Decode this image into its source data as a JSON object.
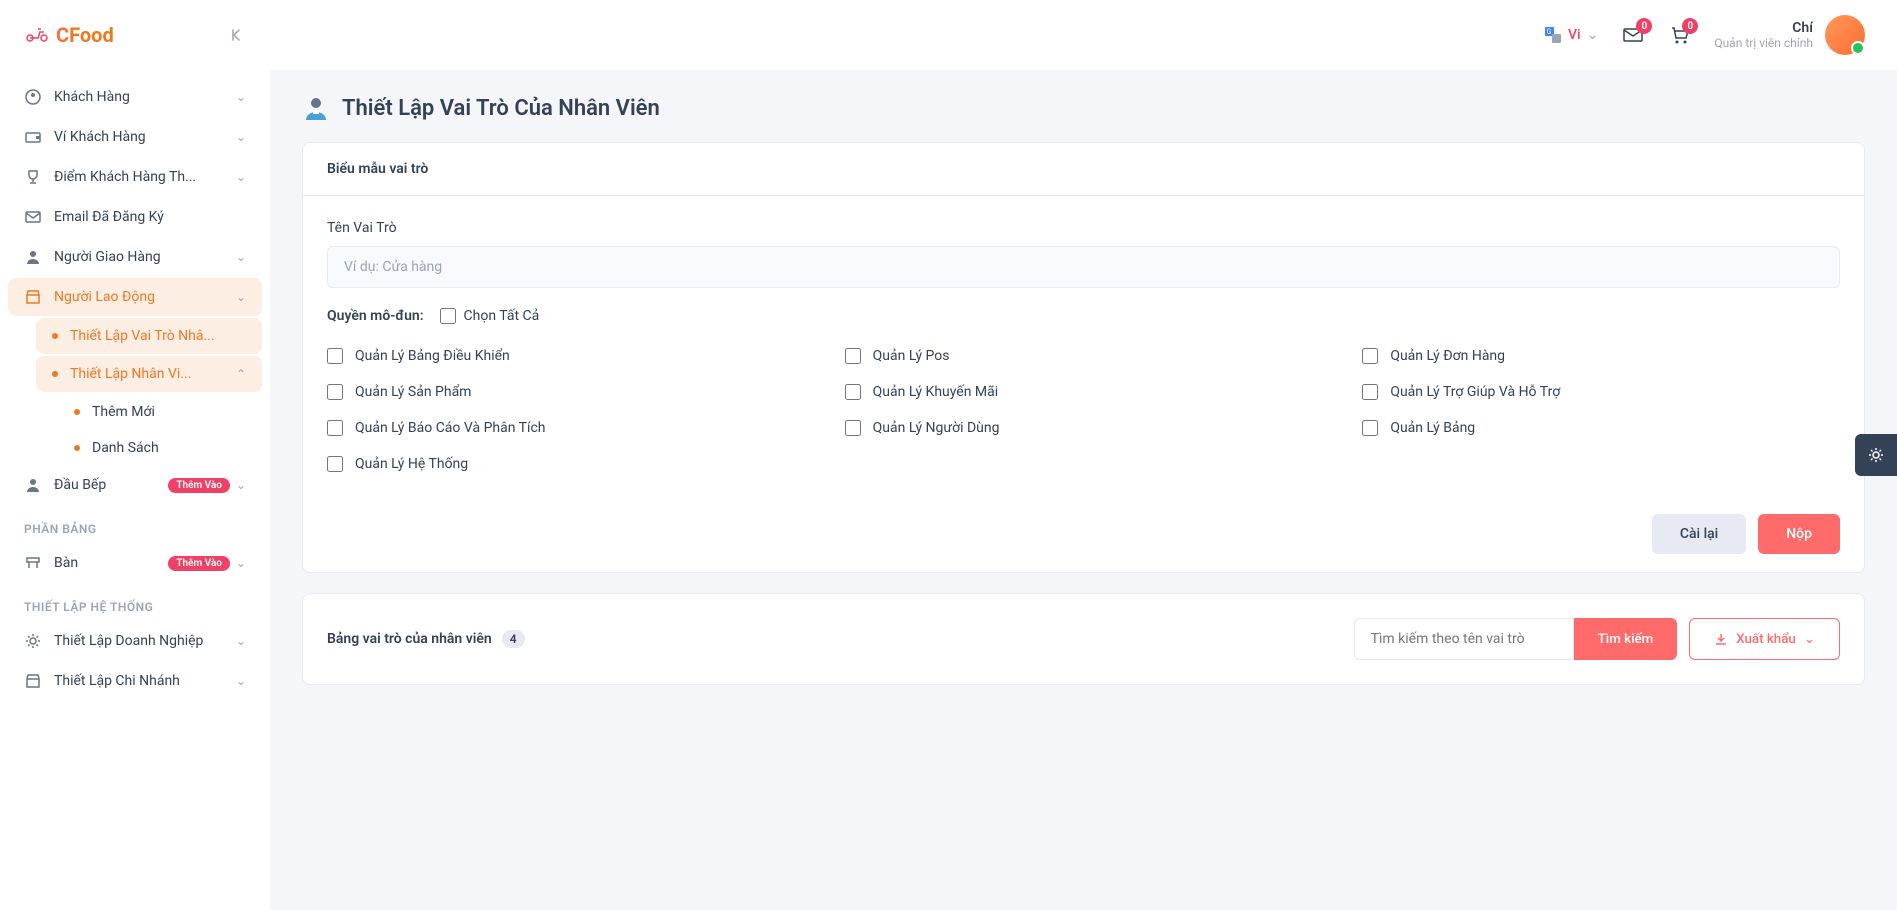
{
  "logo": {
    "brand": "Food",
    "prefix": "C"
  },
  "sidebar": {
    "items": [
      {
        "icon": "user-circle",
        "label": "Khách Hàng",
        "chevron": true
      },
      {
        "icon": "wallet",
        "label": "Ví Khách Hàng",
        "chevron": true
      },
      {
        "icon": "trophy",
        "label": "Điểm Khách Hàng Th...",
        "chevron": true
      },
      {
        "icon": "mail",
        "label": "Email Đã Đăng Ký",
        "chevron": false
      },
      {
        "icon": "person",
        "label": "Người Giao Hàng",
        "chevron": true
      },
      {
        "icon": "store",
        "label": "Người Lao Động",
        "chevron": true,
        "active": true,
        "subs": [
          {
            "label": "Thiết Lập Vai Trò Nhâ...",
            "active": true
          },
          {
            "label": "Thiết Lập Nhân Vi...",
            "active": true,
            "chevron": true,
            "subs": [
              {
                "label": "Thêm Mới"
              },
              {
                "label": "Danh Sách"
              }
            ]
          }
        ]
      },
      {
        "icon": "chef",
        "label": "Đầu Bếp",
        "badge": "Thêm Vào",
        "chevron": true
      }
    ],
    "sections": [
      {
        "title": "PHẦN BẢNG",
        "items": [
          {
            "icon": "table",
            "label": "Bàn",
            "badge": "Thêm Vào",
            "chevron": true
          }
        ]
      },
      {
        "title": "THIẾT LẬP HỆ THỐNG",
        "items": [
          {
            "icon": "gear",
            "label": "Thiết Lập Doanh Nghiệp",
            "chevron": true
          },
          {
            "icon": "branch",
            "label": "Thiết Lập Chi Nhánh",
            "chevron": true
          }
        ]
      }
    ]
  },
  "topbar": {
    "lang": "Vi",
    "msg_count": "0",
    "cart_count": "0",
    "user_name": "Chí",
    "user_role": "Quản trị viên chính"
  },
  "page": {
    "title": "Thiết Lập Vai Trò Của Nhân Viên"
  },
  "form": {
    "header": "Biểu mẫu vai trò",
    "name_label": "Tên Vai Trò",
    "name_placeholder": "Ví dụ: Cửa hàng",
    "module_label": "Quyền mô-đun:",
    "select_all": "Chọn Tất Cả",
    "permissions": [
      "Quản Lý Bảng Điều Khiển",
      "Quản Lý Pos",
      "Quản Lý Đơn Hàng",
      "Quản Lý Sản Phẩm",
      "Quản Lý Khuyến Mãi",
      "Quản Lý Trợ Giúp Và Hỗ Trợ",
      "Quản Lý Báo Cáo Và Phân Tích",
      "Quản Lý Người Dùng",
      "Quản Lý Bảng",
      "Quản Lý Hệ Thống"
    ],
    "reset": "Cài lại",
    "submit": "Nộp"
  },
  "table": {
    "title": "Bảng vai trò của nhân viên",
    "count": "4",
    "search_placeholder": "Tìm kiếm theo tên vai trò",
    "search_btn": "Tìm kiếm",
    "export": "Xuất khẩu"
  }
}
